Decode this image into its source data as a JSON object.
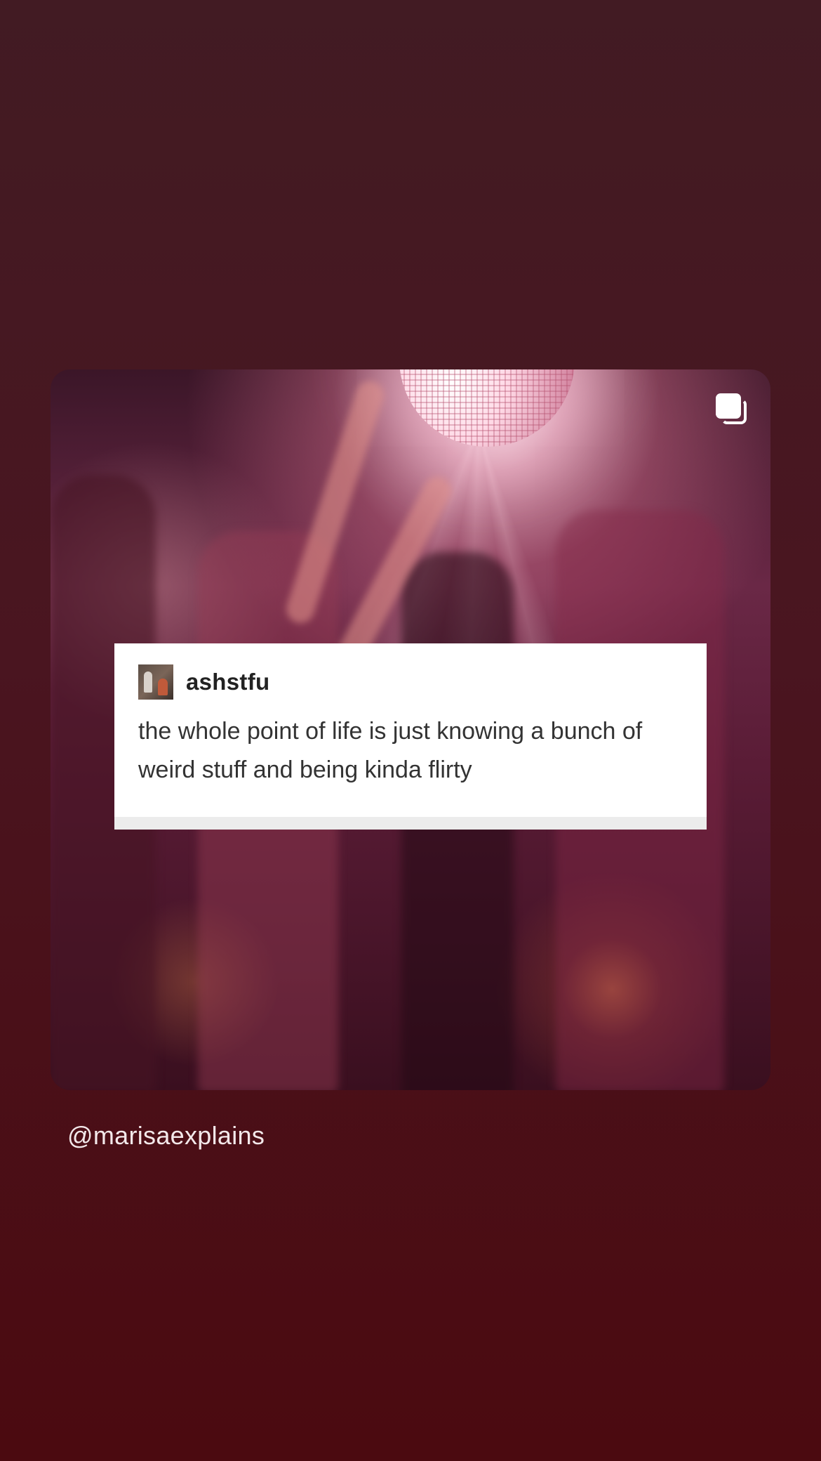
{
  "post": {
    "author": "ashstfu",
    "text": "the whole point of life is just knowing a bunch of weird stuff and being kinda flirty",
    "photo_description_icon": "multiple-images-icon"
  },
  "footer": {
    "handle": "@marisaexplains"
  },
  "colors": {
    "background_top": "#421b23",
    "background_bottom": "#4b0a10",
    "post_box": "#ffffff",
    "handle_text": "#f3e8ea"
  }
}
